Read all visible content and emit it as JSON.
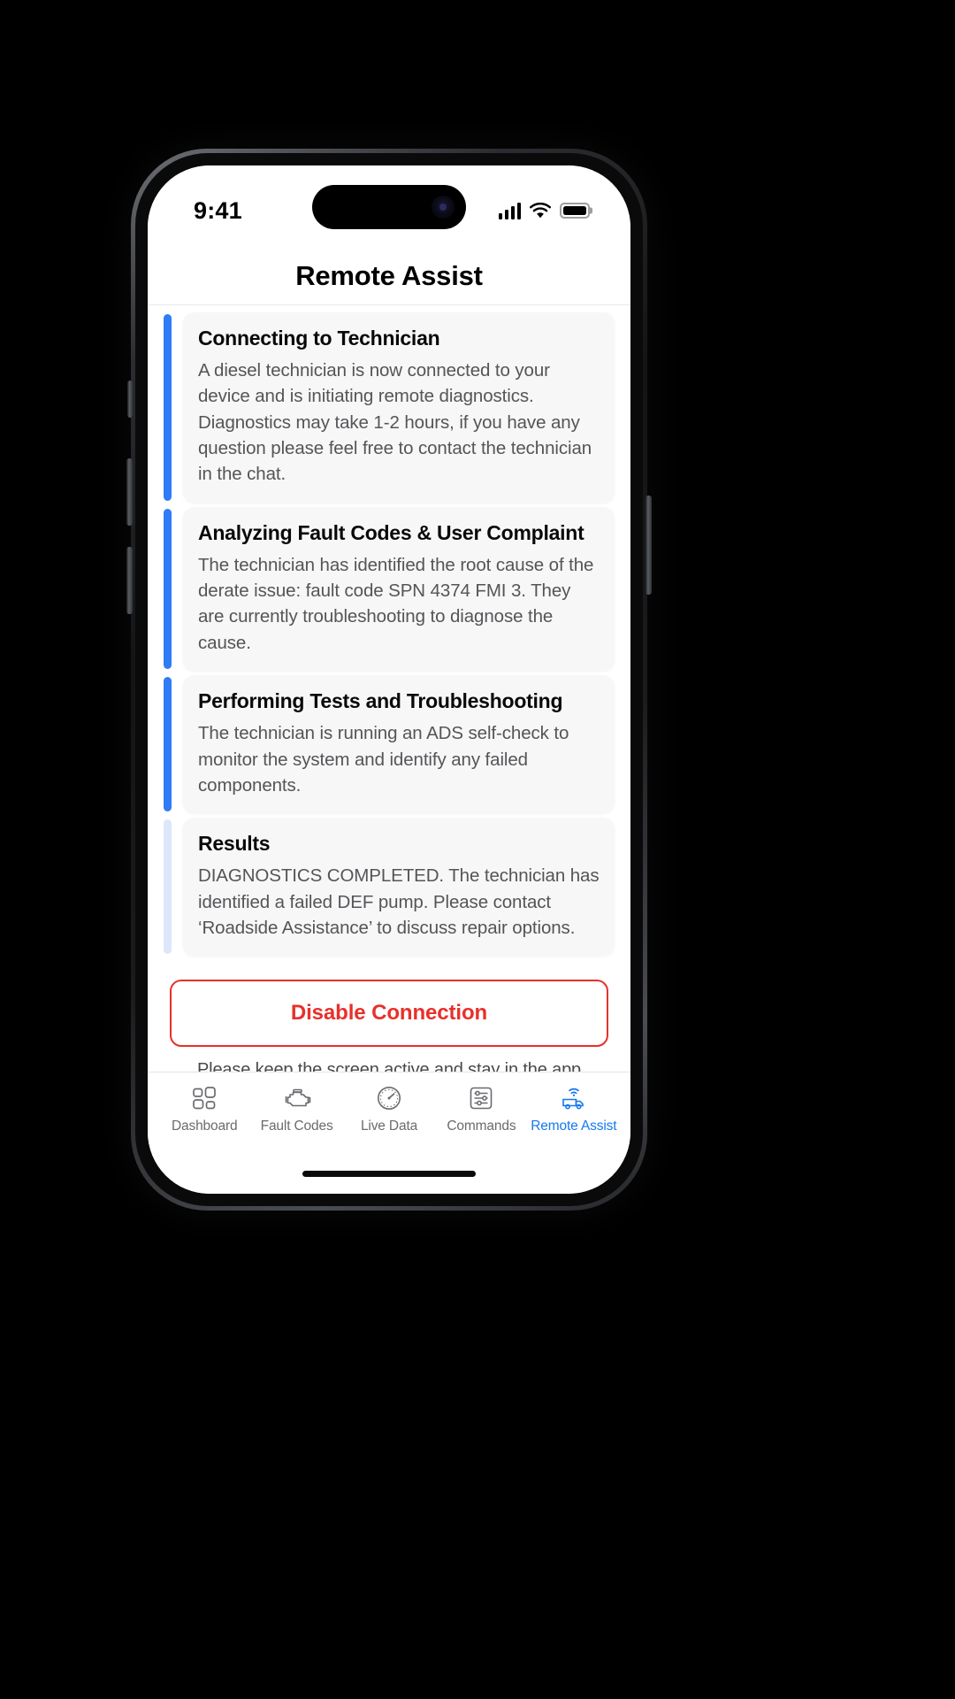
{
  "status_bar": {
    "time": "9:41",
    "cellular_icon": "signal-bars-icon",
    "wifi_icon": "wifi-icon",
    "battery_icon": "battery-full-icon"
  },
  "header": {
    "title": "Remote Assist"
  },
  "timeline": {
    "steps": [
      {
        "title": "Connecting to Technician",
        "body": "A diesel technician is now connected to your device and is initiating remote diagnostics. Diagnostics may take 1-2 hours, if you have any question please feel free to contact the technician in the chat.",
        "state": "complete"
      },
      {
        "title": "Analyzing Fault Codes & User Complaint",
        "body": "The technician has identified the root cause of the derate issue: fault code SPN 4374 FMI 3. They are currently troubleshooting to diagnose the cause.",
        "state": "complete"
      },
      {
        "title": "Performing Tests and Troubleshooting",
        "body": "The technician is running an ADS self-check to monitor the system and identify any failed components.",
        "state": "complete"
      },
      {
        "title": "Results",
        "body": "DIAGNOSTICS COMPLETED. The technician has identified a failed DEF pump. Please contact ‘Roadside Assistance’ to discuss repair options.",
        "state": "pending"
      }
    ]
  },
  "footer": {
    "disable_button_label": "Disable Connection",
    "note": "Please keep the screen active and stay in the app"
  },
  "tab_bar": {
    "tabs": [
      {
        "label": "Dashboard",
        "icon": "grid-squares-icon",
        "active": false
      },
      {
        "label": "Fault Codes",
        "icon": "engine-icon",
        "active": false
      },
      {
        "label": "Live Data",
        "icon": "gauge-icon",
        "active": false
      },
      {
        "label": "Commands",
        "icon": "sliders-icon",
        "active": false
      },
      {
        "label": "Remote Assist",
        "icon": "truck-wifi-icon",
        "active": true
      }
    ]
  },
  "colors": {
    "accent_blue": "#1478f0",
    "rail_active": "#2f7cf6",
    "rail_pending": "#dde7fb",
    "danger_red": "#e8302a",
    "card_bg": "#f7f7f8"
  }
}
